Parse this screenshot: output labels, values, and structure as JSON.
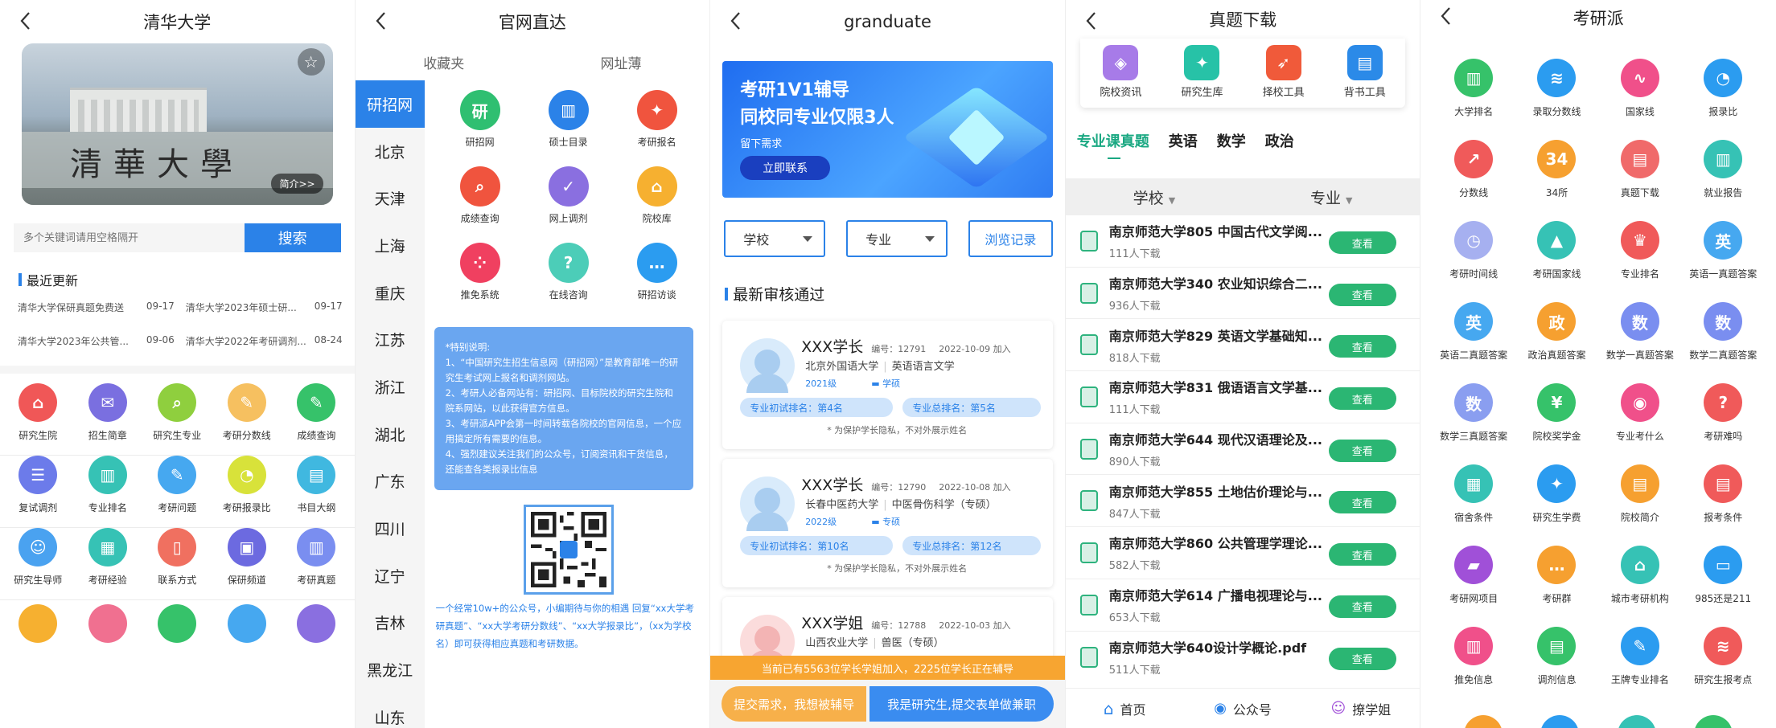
{
  "p1": {
    "title": "清华大学",
    "campus_gate": "清華大學",
    "intro": "简介>>",
    "search_placeholder": "多个关键词请用空格隔开",
    "search_btn": "搜索",
    "recent": "最近更新",
    "news": [
      {
        "t": "清华大学保研真题免费送",
        "d": "09-17"
      },
      {
        "t": "清华大学2023年硕士研...",
        "d": "09-17"
      },
      {
        "t": "清华大学2023年公共管...",
        "d": "09-06"
      },
      {
        "t": "清华大学2022年考研调剂...",
        "d": "08-24"
      }
    ],
    "grid": [
      {
        "l": "研究生院",
        "c": "#f05757",
        "g": "⌂",
        "i": "school-icon"
      },
      {
        "l": "招生简章",
        "c": "#7a6fe0",
        "g": "✉",
        "i": "brochure-icon"
      },
      {
        "l": "研究生专业",
        "c": "#8fcf3e",
        "g": "⌕",
        "i": "major-icon"
      },
      {
        "l": "考研分数线",
        "c": "#f6c060",
        "g": "✎",
        "i": "score-line-icon"
      },
      {
        "l": "成绩查询",
        "c": "#36c26a",
        "g": "✎",
        "i": "grade-icon"
      },
      {
        "l": "复试调剂",
        "c": "#6c7bea",
        "g": "☰",
        "i": "retest-icon"
      },
      {
        "l": "专业排名",
        "c": "#36c2b5",
        "g": "▥",
        "i": "ranking-icon"
      },
      {
        "l": "考研问题",
        "c": "#46a8f0",
        "g": "✎",
        "i": "question-icon"
      },
      {
        "l": "考研报录比",
        "c": "#d8e23a",
        "g": "◔",
        "i": "ratio-icon"
      },
      {
        "l": "书目大纲",
        "c": "#40b8e0",
        "g": "▤",
        "i": "book-icon"
      },
      {
        "l": "研究生导师",
        "c": "#4aa2f0",
        "g": "☺",
        "i": "tutor-icon"
      },
      {
        "l": "考研经验",
        "c": "#36c2b5",
        "g": "▦",
        "i": "experience-icon"
      },
      {
        "l": "联系方式",
        "c": "#f07060",
        "g": "▯",
        "i": "contact-icon"
      },
      {
        "l": "保研频道",
        "c": "#6c6ae0",
        "g": "▣",
        "i": "channel-icon"
      },
      {
        "l": "考研真题",
        "c": "#7a8ef0",
        "g": "▥",
        "i": "exam-icon"
      }
    ],
    "partial": [
      {
        "c": "#f6b030"
      },
      {
        "c": "#f07090"
      },
      {
        "c": "#36c26a"
      },
      {
        "c": "#46a8f0"
      },
      {
        "c": "#8a6fe0"
      }
    ]
  },
  "p2": {
    "title": "官网直达",
    "tabs": [
      "收藏夹",
      "网址薄"
    ],
    "regions": [
      "研招网",
      "北京",
      "天津",
      "上海",
      "重庆",
      "江苏",
      "浙江",
      "湖北",
      "广东",
      "四川",
      "辽宁",
      "吉林",
      "黑龙江",
      "山东"
    ],
    "grid": [
      {
        "l": "研招网",
        "c": "#2fbf71",
        "g": "研",
        "i": "yanzhao-icon"
      },
      {
        "l": "硕士目录",
        "c": "#2b82e8",
        "g": "▥",
        "i": "catalog-icon"
      },
      {
        "l": "考研报名",
        "c": "#f0543e",
        "g": "✦",
        "i": "register-icon"
      },
      {
        "l": "成绩查询",
        "c": "#f0543e",
        "g": "⌕",
        "i": "grade-query-icon"
      },
      {
        "l": "网上调剂",
        "c": "#8a6fe0",
        "g": "✓",
        "i": "adjust-icon"
      },
      {
        "l": "院校库",
        "c": "#f6b030",
        "g": "⌂",
        "i": "college-lib-icon"
      },
      {
        "l": "推免系统",
        "c": "#f04060",
        "g": "⁘",
        "i": "recommend-icon"
      },
      {
        "l": "在线咨询",
        "c": "#4ccdb8",
        "g": "?",
        "i": "consult-icon"
      },
      {
        "l": "研招访谈",
        "c": "#2b9cf0",
        "g": "…",
        "i": "interview-icon"
      }
    ],
    "notice": [
      "*特别说明:",
      "1、“中国研究生招生信息网（研招网）”是教育部唯一的研究生考试网上报名和调剂网站。",
      "2、考研人必备网站有：研招网、目标院校的研究生院和院系网站，以此获得官方信息。",
      "3、考研派APP会第一时间转载各院校的官网信息，一个应用搞定所有需要的信息。",
      "4、强烈建议关注我们的公众号，订阅资讯和干货信息，还能查各类报录比信息"
    ],
    "qr_caption": "一个经常10w+的公众号，小编期待与你的相遇 回复“xx大学考研真题”、“xx大学考研分数线”、“xx大学报录比”，（xx为学校名）即可获得相应真题和考研数据。"
  },
  "p3": {
    "title": "granduate",
    "banner_line1": "考研1V1辅导",
    "banner_line2": "同校同专业仅限3人",
    "banner_sub": "留下需求",
    "banner_btn": "立即联系",
    "filter_school": "学校",
    "filter_major": "专业",
    "history": "浏览记录",
    "section": "最新审核通过",
    "cards": [
      {
        "name": "XXX学长",
        "no": "编号：12791",
        "date": "2022-10-09 加入",
        "school": "北京外国语大学",
        "major": "英语语言文学",
        "year": "2021级",
        "tag": "学硕",
        "r1": "专业初试排名：第4名",
        "r2": "专业总排名：第5名",
        "note": "* 为保护学长隐私，不对外展示姓名"
      },
      {
        "name": "XXX学长",
        "no": "编号：12790",
        "date": "2022-10-08 加入",
        "school": "长春中医药大学",
        "major": "中医骨伤科学（专硕）",
        "year": "2022级",
        "tag": "专硕",
        "r1": "专业初试排名：第10名",
        "r2": "专业总排名：第12名",
        "note": "* 为保护学长隐私，不对外展示姓名"
      },
      {
        "name": "XXX学姐",
        "no": "编号：12788",
        "date": "2022-10-03 加入",
        "school": "山西农业大学",
        "major": "兽医（专硕）"
      }
    ],
    "ticker": "当前已有5563位学长学姐加入，2225位学长正在辅导",
    "btn_need": "提交需求，我想被辅导",
    "btn_grad": "我是研究生,提交表单做兼职"
  },
  "p4": {
    "title": "真题下载",
    "tools": [
      {
        "l": "院校资讯",
        "c": "#a77be8",
        "g": "◈",
        "i": "news-icon"
      },
      {
        "l": "研究生库",
        "c": "#27c2a7",
        "g": "✦",
        "i": "grad-lib-icon"
      },
      {
        "l": "择校工具",
        "c": "#f05a3a",
        "g": "➶",
        "i": "choose-tool-icon"
      },
      {
        "l": "背书工具",
        "c": "#2b8ae8",
        "g": "▤",
        "i": "recite-tool-icon"
      }
    ],
    "subtabs": [
      "专业课真题",
      "英语",
      "数学",
      "政治"
    ],
    "hdr_school": "学校",
    "hdr_major": "专业",
    "rows": [
      {
        "t": "南京师范大学805 中国古代文学阅...",
        "s": "111人下载"
      },
      {
        "t": "南京师范大学340 农业知识综合二...",
        "s": "936人下载"
      },
      {
        "t": "南京师范大学829 英语文学基础知...",
        "s": "818人下载"
      },
      {
        "t": "南京师范大学831 俄语语言文学基...",
        "s": "111人下载"
      },
      {
        "t": "南京师范大学644 现代汉语理论及...",
        "s": "890人下载"
      },
      {
        "t": "南京师范大学855 土地估价理论与...",
        "s": "847人下载"
      },
      {
        "t": "南京师范大学860 公共管理学理论...",
        "s": "582人下载"
      },
      {
        "t": "南京师范大学614 广播电视理论与...",
        "s": "653人下载"
      },
      {
        "t": "南京师范大学640设计学概论.pdf",
        "s": "511人下载"
      }
    ],
    "view": "查看",
    "nav": [
      "首页",
      "公众号",
      "撩学姐"
    ]
  },
  "p5": {
    "title": "考研派",
    "grid": [
      {
        "l": "大学排名",
        "c": "#36c26a",
        "g": "▥",
        "i": "univ-rank-icon"
      },
      {
        "l": "录取分数线",
        "c": "#2b9cf0",
        "g": "≋",
        "i": "admit-score-icon"
      },
      {
        "l": "国家线",
        "c": "#f0508a",
        "g": "∿",
        "i": "national-line-icon"
      },
      {
        "l": "报录比",
        "c": "#2b9cf0",
        "g": "◔",
        "i": "ratio2-icon"
      },
      {
        "l": "分数线",
        "c": "#f05a5a",
        "g": "↗",
        "i": "score-icon"
      },
      {
        "l": "34所",
        "c": "#f6a030",
        "g": "34",
        "i": "34-icon"
      },
      {
        "l": "真题下载",
        "c": "#f06a6a",
        "g": "▤",
        "i": "download-icon"
      },
      {
        "l": "就业报告",
        "c": "#36c2b5",
        "g": "▥",
        "i": "employ-icon"
      },
      {
        "l": "考研时间线",
        "c": "#a6b0f0",
        "g": "◷",
        "i": "timeline-icon"
      },
      {
        "l": "考研国家线",
        "c": "#36c2b5",
        "g": "▲",
        "i": "nat-line-icon"
      },
      {
        "l": "专业排名",
        "c": "#f05a5a",
        "g": "♛",
        "i": "major-rank-icon"
      },
      {
        "l": "英语一真题答案",
        "c": "#46a8f0",
        "g": "英",
        "i": "eng1-icon"
      },
      {
        "l": "英语二真题答案",
        "c": "#46a8f0",
        "g": "英",
        "i": "eng2-icon"
      },
      {
        "l": "政治真题答案",
        "c": "#f6a030",
        "g": "政",
        "i": "politics-icon"
      },
      {
        "l": "数学一真题答案",
        "c": "#7a8ef0",
        "g": "数",
        "i": "math1-icon"
      },
      {
        "l": "数学二真题答案",
        "c": "#7a8ef0",
        "g": "数",
        "i": "math2-icon"
      },
      {
        "l": "数学三真题答案",
        "c": "#8a9ef0",
        "g": "数",
        "i": "math3-icon"
      },
      {
        "l": "院校奖学金",
        "c": "#36c26a",
        "g": "¥",
        "i": "scholarship-icon"
      },
      {
        "l": "专业考什么",
        "c": "#f0508a",
        "g": "◉",
        "i": "major-exam-icon"
      },
      {
        "l": "考研难吗",
        "c": "#f05a5a",
        "g": "?",
        "i": "difficulty-icon"
      },
      {
        "l": "宿舍条件",
        "c": "#36c2b5",
        "g": "▦",
        "i": "dorm-icon"
      },
      {
        "l": "研究生学费",
        "c": "#2b9cf0",
        "g": "✦",
        "i": "tuition-icon"
      },
      {
        "l": "院校简介",
        "c": "#f6a030",
        "g": "▤",
        "i": "intro-icon"
      },
      {
        "l": "报考条件",
        "c": "#f05a5a",
        "g": "▤",
        "i": "condition-icon"
      },
      {
        "l": "考研网项目",
        "c": "#a050d8",
        "g": "▰",
        "i": "project-icon"
      },
      {
        "l": "考研群",
        "c": "#f6a030",
        "g": "…",
        "i": "group-icon"
      },
      {
        "l": "城市考研机构",
        "c": "#36c2b5",
        "g": "⌂",
        "i": "city-org-icon"
      },
      {
        "l": "985还是211",
        "c": "#2b9cf0",
        "g": "▭",
        "i": "985-icon"
      },
      {
        "l": "推免信息",
        "c": "#f0508a",
        "g": "▥",
        "i": "recommend-info-icon"
      },
      {
        "l": "调剂信息",
        "c": "#36c26a",
        "g": "▤",
        "i": "adjust-info-icon"
      },
      {
        "l": "王牌专业排名",
        "c": "#2b9cf0",
        "g": "✎",
        "i": "ace-major-icon"
      },
      {
        "l": "研究生报考点",
        "c": "#f05a5a",
        "g": "≋",
        "i": "exam-site-icon"
      }
    ]
  }
}
